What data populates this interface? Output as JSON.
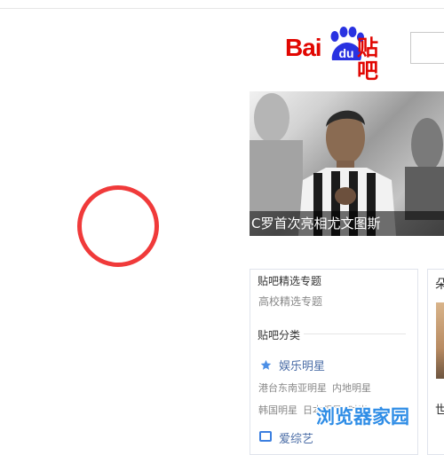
{
  "logo": {
    "bai": "Bai",
    "du": "du",
    "tieba": "贴吧"
  },
  "search": {
    "placeholder": ""
  },
  "hero": {
    "caption": "C罗首次亮相尤文图斯"
  },
  "panel": {
    "featured_title": "贴吧精选专题",
    "featured_item": "高校精选专题",
    "categories_title": "贴吧分类",
    "cat1": {
      "title": "娱乐明星",
      "row1": [
        "港台东南亚明星",
        "内地明星"
      ],
      "row2": [
        "韩国明星",
        "日本明星",
        "时尚"
      ]
    },
    "cat2": {
      "title": "爱综艺"
    }
  },
  "panel2": {
    "head": "朵",
    "foot": "世"
  },
  "watermark": "浏览器家园",
  "colors": {
    "brand": "#e10601",
    "annotation": "#f03a3a",
    "link": "#4a6ca6",
    "watermark": "#2f8de6"
  }
}
